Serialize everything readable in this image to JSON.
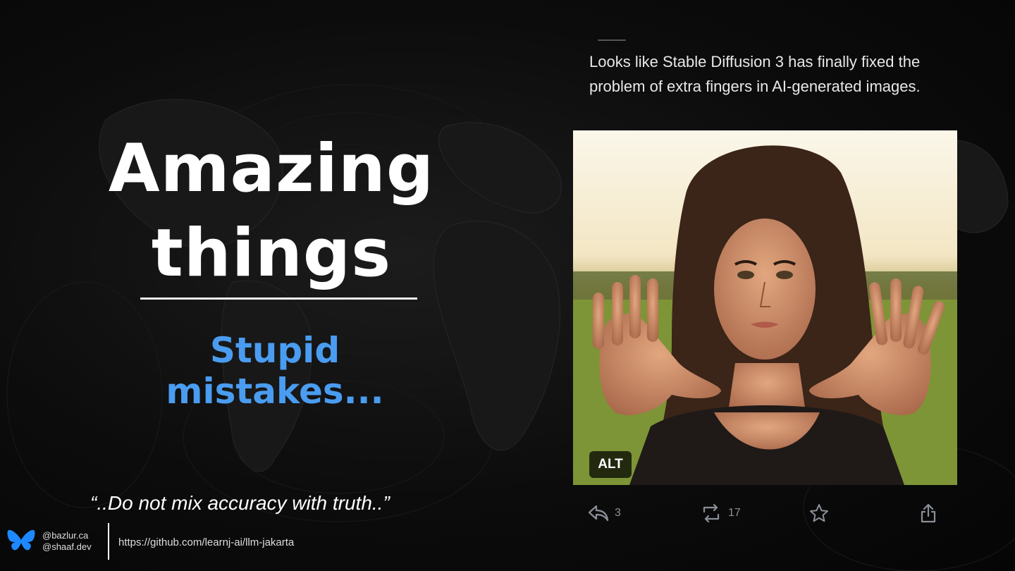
{
  "slide": {
    "title_line1": "Amazing",
    "title_line2": "things",
    "subtitle": "Stupid mistakes...",
    "quote": "“..Do not mix accuracy with truth..”",
    "subtitle_color": "#4a9cf0"
  },
  "footer": {
    "logo_icon": "butterfly-icon",
    "handle1": "@bazlur.ca",
    "handle2": "@shaaf.dev",
    "url": "https://github.com/learnj-ai/llm-jakarta"
  },
  "post": {
    "text": "Looks like Stable Diffusion 3 has finally fixed the problem of extra fingers in AI-generated images.",
    "image_icon": "ai-generated-photo",
    "alt_badge": "ALT",
    "actions": {
      "reply_count": "3",
      "repost_count": "17",
      "reply_icon": "reply-icon",
      "repost_icon": "repost-icon",
      "favorite_icon": "star-icon",
      "share_icon": "share-icon"
    }
  }
}
